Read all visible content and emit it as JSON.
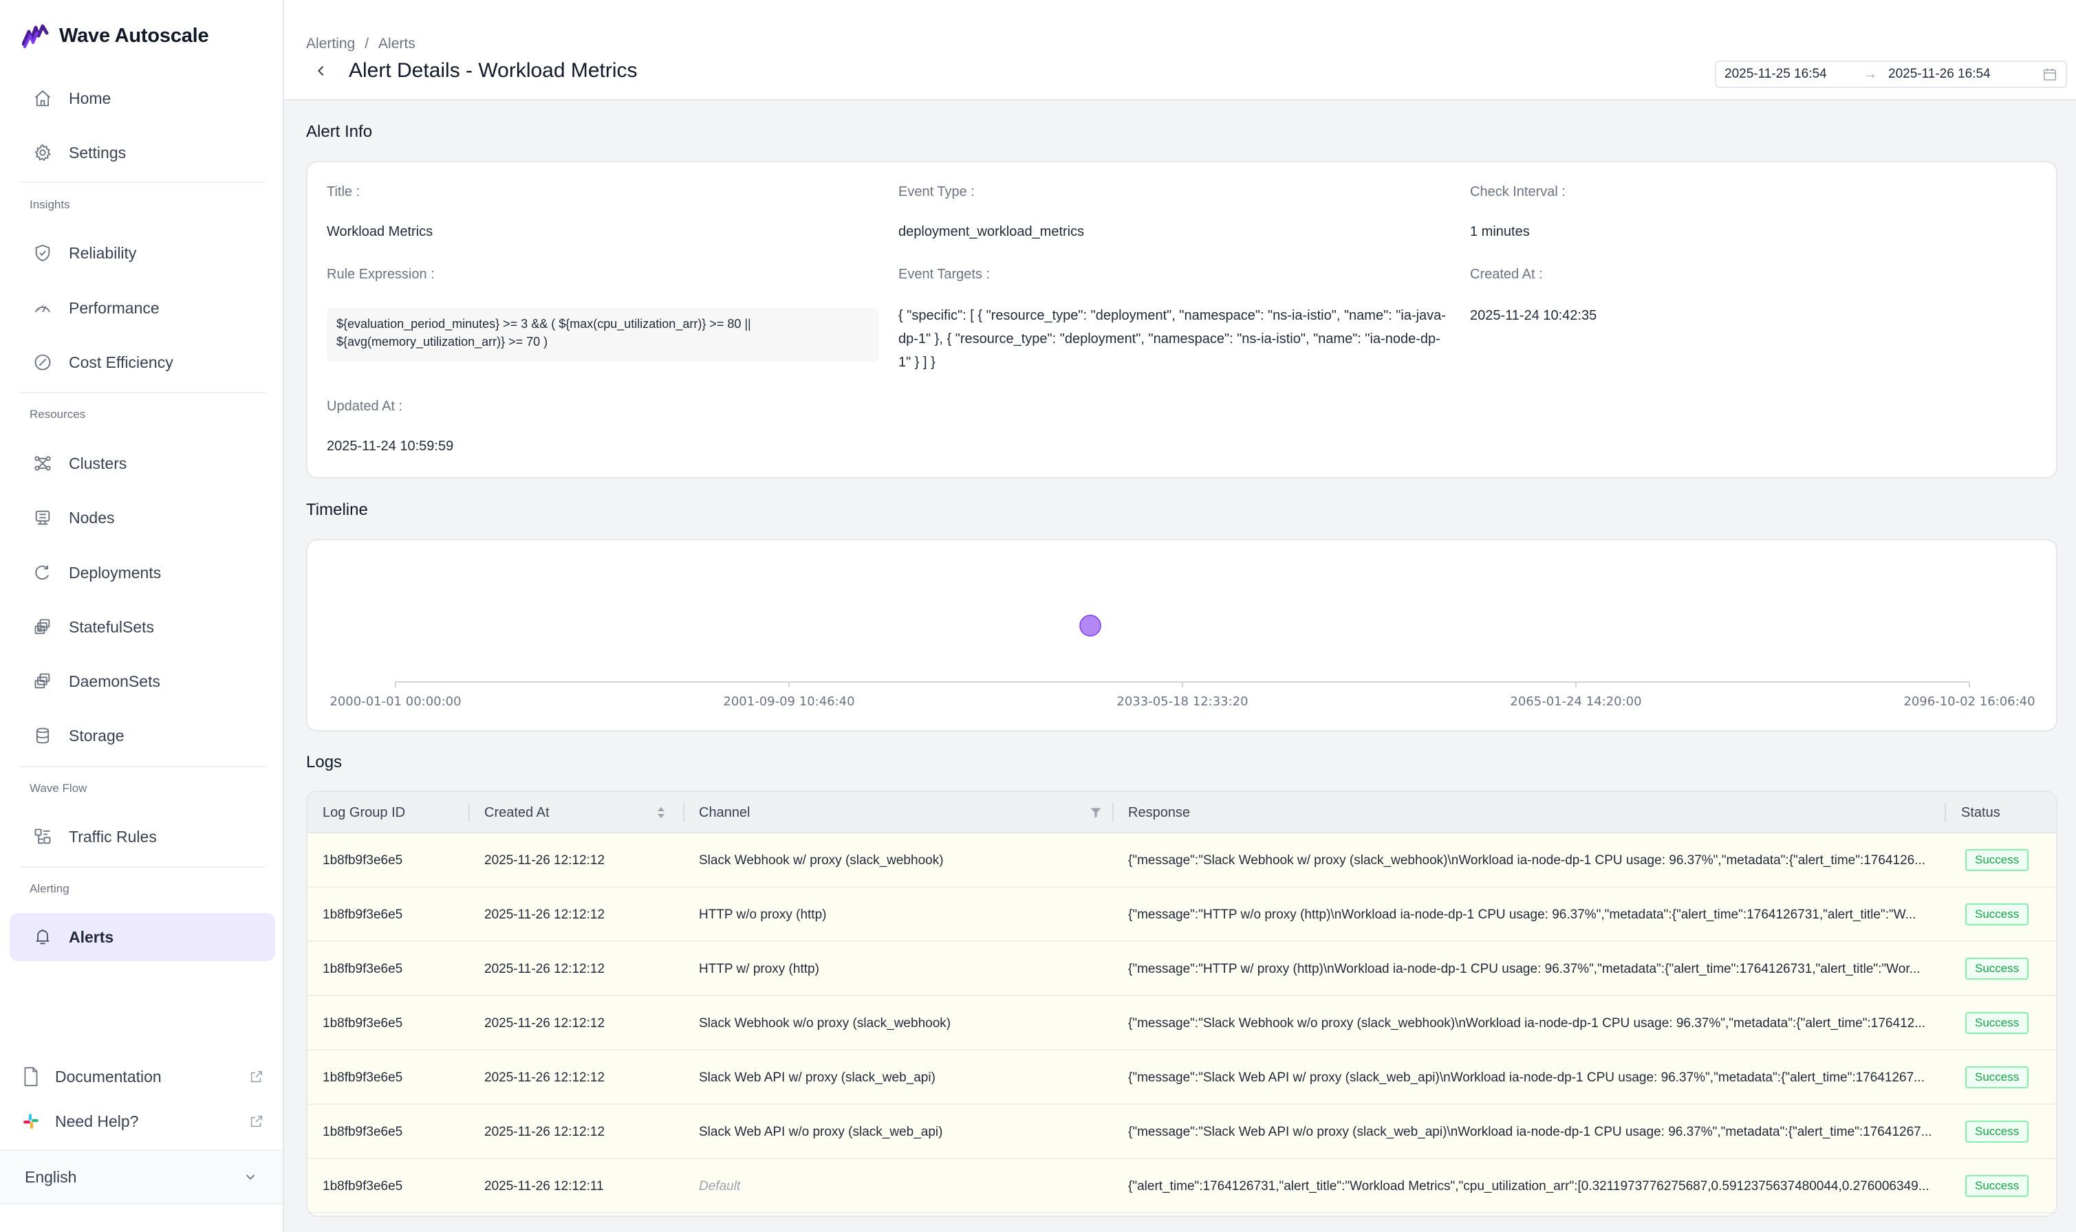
{
  "app": {
    "name": "Wave Autoscale"
  },
  "sidebar": {
    "home": "Home",
    "settings": "Settings",
    "insights_label": "Insights",
    "reliability": "Reliability",
    "performance": "Performance",
    "cost_efficiency": "Cost Efficiency",
    "resources_label": "Resources",
    "clusters": "Clusters",
    "nodes": "Nodes",
    "deployments": "Deployments",
    "statefulsets": "StatefulSets",
    "daemonsets": "DaemonSets",
    "storage": "Storage",
    "waveflow_label": "Wave Flow",
    "traffic_rules": "Traffic Rules",
    "alerting_label": "Alerting",
    "alerts": "Alerts",
    "documentation": "Documentation",
    "need_help": "Need Help?",
    "language": "English"
  },
  "header": {
    "breadcrumb": [
      "Alerting",
      "/",
      "Alerts"
    ],
    "title": "Alert Details - Workload Metrics",
    "date_from": "2025-11-25 16:54",
    "date_to": "2025-11-26 16:54"
  },
  "alert_info": {
    "section_title": "Alert Info",
    "title_label": "Title :",
    "title_value": "Workload Metrics",
    "event_type_label": "Event Type :",
    "event_type_value": "deployment_workload_metrics",
    "check_interval_label": "Check Interval :",
    "check_interval_value": "1 minutes",
    "rule_expression_label": "Rule Expression :",
    "rule_expression_value": "${evaluation_period_minutes} >= 3 && ( ${max(cpu_utilization_arr)} >= 80 || ${avg(memory_utilization_arr)} >= 70 )",
    "event_targets_label": "Event Targets :",
    "event_targets_value": "{ \"specific\": [ { \"resource_type\": \"deployment\", \"namespace\": \"ns-ia-istio\", \"name\": \"ia-java-dp-1\" }, { \"resource_type\": \"deployment\", \"namespace\": \"ns-ia-istio\", \"name\": \"ia-node-dp-1\" } ] }",
    "created_at_label": "Created At :",
    "created_at_value": "2025-11-24 10:42:35",
    "updated_at_label": "Updated At :",
    "updated_at_value": "2025-11-24 10:59:59"
  },
  "timeline": {
    "section_title": "Timeline",
    "ticks": [
      "2000-01-01 00:00:00",
      "2001-09-09 10:46:40",
      "2033-05-18 12:33:20",
      "2065-01-24 14:20:00",
      "2096-10-02 16:06:40"
    ],
    "marker_color": "#b388f5"
  },
  "logs": {
    "section_title": "Logs",
    "columns": [
      "Log Group ID",
      "Created At",
      "Channel",
      "Response",
      "Status"
    ],
    "rows": [
      {
        "id": "1b8fb9f3e6e5",
        "created": "2025-11-26 12:12:12",
        "channel": "Slack Webhook w/ proxy (slack_webhook)",
        "response": "{\"message\":\"Slack Webhook w/ proxy (slack_webhook)\\nWorkload ia-node-dp-1 CPU usage: 96.37%\",\"metadata\":{\"alert_time\":1764126...",
        "status": "Success"
      },
      {
        "id": "1b8fb9f3e6e5",
        "created": "2025-11-26 12:12:12",
        "channel": "HTTP w/o proxy (http)",
        "response": "{\"message\":\"HTTP w/o proxy (http)\\nWorkload ia-node-dp-1 CPU usage: 96.37%\",\"metadata\":{\"alert_time\":1764126731,\"alert_title\":\"W...",
        "status": "Success"
      },
      {
        "id": "1b8fb9f3e6e5",
        "created": "2025-11-26 12:12:12",
        "channel": "HTTP w/ proxy (http)",
        "response": "{\"message\":\"HTTP w/ proxy (http)\\nWorkload ia-node-dp-1 CPU usage: 96.37%\",\"metadata\":{\"alert_time\":1764126731,\"alert_title\":\"Wor...",
        "status": "Success"
      },
      {
        "id": "1b8fb9f3e6e5",
        "created": "2025-11-26 12:12:12",
        "channel": "Slack Webhook w/o proxy (slack_webhook)",
        "response": "{\"message\":\"Slack Webhook w/o proxy (slack_webhook)\\nWorkload ia-node-dp-1 CPU usage: 96.37%\",\"metadata\":{\"alert_time\":176412...",
        "status": "Success"
      },
      {
        "id": "1b8fb9f3e6e5",
        "created": "2025-11-26 12:12:12",
        "channel": "Slack Web API w/ proxy (slack_web_api)",
        "response": "{\"message\":\"Slack Web API w/ proxy (slack_web_api)\\nWorkload ia-node-dp-1 CPU usage: 96.37%\",\"metadata\":{\"alert_time\":17641267...",
        "status": "Success"
      },
      {
        "id": "1b8fb9f3e6e5",
        "created": "2025-11-26 12:12:12",
        "channel": "Slack Web API w/o proxy (slack_web_api)",
        "response": "{\"message\":\"Slack Web API w/o proxy (slack_web_api)\\nWorkload ia-node-dp-1 CPU usage: 96.37%\",\"metadata\":{\"alert_time\":17641267...",
        "status": "Success"
      },
      {
        "id": "1b8fb9f3e6e5",
        "created": "2025-11-26 12:12:11",
        "channel": "Default",
        "channel_default": true,
        "response": "{\"alert_time\":1764126731,\"alert_title\":\"Workload Metrics\",\"cpu_utilization_arr\":[0.3211973776275687,0.5912375637480044,0.276006349...",
        "status": "Success"
      }
    ]
  }
}
